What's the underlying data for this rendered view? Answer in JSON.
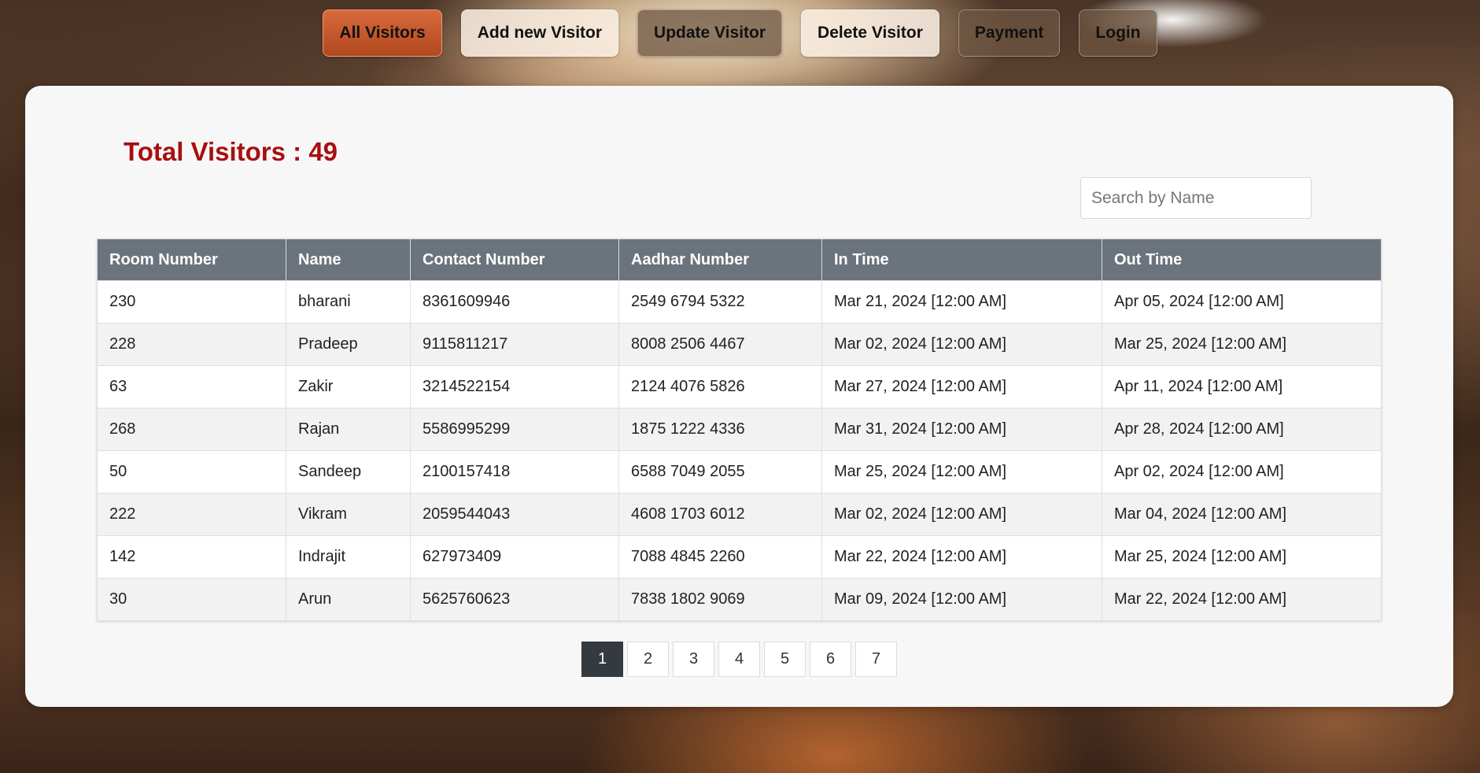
{
  "nav": [
    {
      "label": "All Visitors",
      "style": "active"
    },
    {
      "label": "Add new Visitor",
      "style": "light"
    },
    {
      "label": "Update Visitor",
      "style": "dark"
    },
    {
      "label": "Delete Visitor",
      "style": "light"
    },
    {
      "label": "Payment",
      "style": "dark"
    },
    {
      "label": "Login",
      "style": "dark"
    }
  ],
  "summary": {
    "total_label": "Total Visitors : 49"
  },
  "search": {
    "placeholder": "Search by Name",
    "value": ""
  },
  "table": {
    "columns": [
      "Room Number",
      "Name",
      "Contact Number",
      "Aadhar Number",
      "In Time",
      "Out Time"
    ],
    "rows": [
      [
        "230",
        "bharani",
        "8361609946",
        "2549 6794 5322",
        "Mar 21, 2024 [12:00 AM]",
        "Apr 05, 2024 [12:00 AM]"
      ],
      [
        "228",
        "Pradeep",
        "9115811217",
        "8008 2506 4467",
        "Mar 02, 2024 [12:00 AM]",
        "Mar 25, 2024 [12:00 AM]"
      ],
      [
        "63",
        "Zakir",
        "3214522154",
        "2124 4076 5826",
        "Mar 27, 2024 [12:00 AM]",
        "Apr 11, 2024 [12:00 AM]"
      ],
      [
        "268",
        "Rajan",
        "5586995299",
        "1875 1222 4336",
        "Mar 31, 2024 [12:00 AM]",
        "Apr 28, 2024 [12:00 AM]"
      ],
      [
        "50",
        "Sandeep",
        "2100157418",
        "6588 7049 2055",
        "Mar 25, 2024 [12:00 AM]",
        "Apr 02, 2024 [12:00 AM]"
      ],
      [
        "222",
        "Vikram",
        "2059544043",
        "4608 1703 6012",
        "Mar 02, 2024 [12:00 AM]",
        "Mar 04, 2024 [12:00 AM]"
      ],
      [
        "142",
        "Indrajit",
        "627973409",
        "7088 4845 2260",
        "Mar 22, 2024 [12:00 AM]",
        "Mar 25, 2024 [12:00 AM]"
      ],
      [
        "30",
        "Arun",
        "5625760623",
        "7838 1802 9069",
        "Mar 09, 2024 [12:00 AM]",
        "Mar 22, 2024 [12:00 AM]"
      ]
    ]
  },
  "pagination": {
    "pages": [
      "1",
      "2",
      "3",
      "4",
      "5",
      "6",
      "7"
    ],
    "current": "1"
  },
  "colors": {
    "accent_active": "#c4572b",
    "total_text": "#a80f0f",
    "table_header": "#6b737d",
    "page_active": "#343a40"
  }
}
